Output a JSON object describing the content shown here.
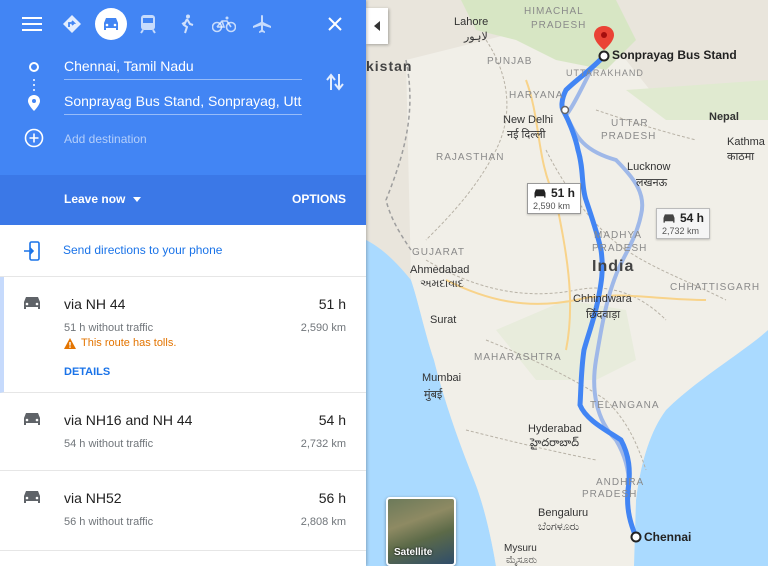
{
  "panel": {
    "travel_modes": [
      {
        "name": "driving-icon",
        "active": true
      },
      {
        "name": "transit-icon",
        "active": false
      },
      {
        "name": "walking-icon",
        "active": false
      },
      {
        "name": "cycling-icon",
        "active": false
      },
      {
        "name": "flight-icon",
        "active": false
      }
    ],
    "origin": "Chennai, Tamil Nadu",
    "destination": "Sonprayag Bus Stand, Sonprayag, Uttarakhand",
    "add_destination": "Add destination",
    "leave_now": "Leave now",
    "options": "OPTIONS",
    "send_directions": "Send directions to your phone",
    "routes": [
      {
        "via": "via NH 44",
        "duration": "51 h",
        "traffic": "51 h without traffic",
        "distance": "2,590 km",
        "warning": "This route has tolls.",
        "details": "DETAILS",
        "selected": true
      },
      {
        "via": "via NH16 and NH 44",
        "duration": "54 h",
        "traffic": "54 h without traffic",
        "distance": "2,732 km"
      },
      {
        "via": "via NH52",
        "duration": "56 h",
        "traffic": "56 h without traffic",
        "distance": "2,808 km"
      }
    ]
  },
  "map": {
    "labels": {
      "lahore": "Lahore",
      "lahore_local": "لاہور",
      "himachal": "HIMACHAL",
      "pradesh1": "PRADESH",
      "pakistan": "kistan",
      "punjab": "PUNJAB",
      "uttarakhand": "UTTARAKHAND",
      "haryana": "HARYANA",
      "new_delhi": "New Delhi",
      "new_delhi_local": "नई दिल्ली",
      "uttar": "UTTAR",
      "pradesh2": "PRADESH",
      "nepal": "Nepal",
      "kathmandu": "Kathma",
      "kathmandu_local": "काठमा",
      "rajasthan": "RAJASTHAN",
      "lucknow": "Lucknow",
      "lucknow_local": "लखनऊ",
      "madhya": "MADHYA",
      "pradesh3": "PRADESH",
      "gujarat": "GUJARAT",
      "india": "India",
      "ahmedabad": "Ahmedabad",
      "ahmedabad_local": "અમદાવાદ",
      "chhattisgarh": "CHHATTISGARH",
      "chhindwara": "Chhindwara",
      "chhindwara_local": "छिंदवाड़ा",
      "surat": "Surat",
      "maharashtra": "MAHARASHTRA",
      "mumbai": "Mumbai",
      "mumbai_local": "मुंबई",
      "telangana": "TELANGANA",
      "hyderabad": "Hyderabad",
      "hyderabad_local": "హైదరాబాద్",
      "andhra": "ANDHRA",
      "pradesh4": "PRADESH",
      "bengaluru": "Bengaluru",
      "bengaluru_local": "ಬೆಂಗಳೂರು",
      "mysuru": "Mysuru",
      "mysuru_local": "ಮೈಸೂರು",
      "sonprayag": "Sonprayag Bus Stand",
      "chennai": "Chennai"
    },
    "callouts": [
      {
        "duration": "51 h",
        "distance": "2,590 km"
      },
      {
        "duration": "54 h",
        "distance": "2,732 km"
      }
    ],
    "satellite_label": "Satellite",
    "colors": {
      "route": "#4285f4",
      "alt_route": "#9fb8e8",
      "pin": "#ea4335"
    }
  }
}
